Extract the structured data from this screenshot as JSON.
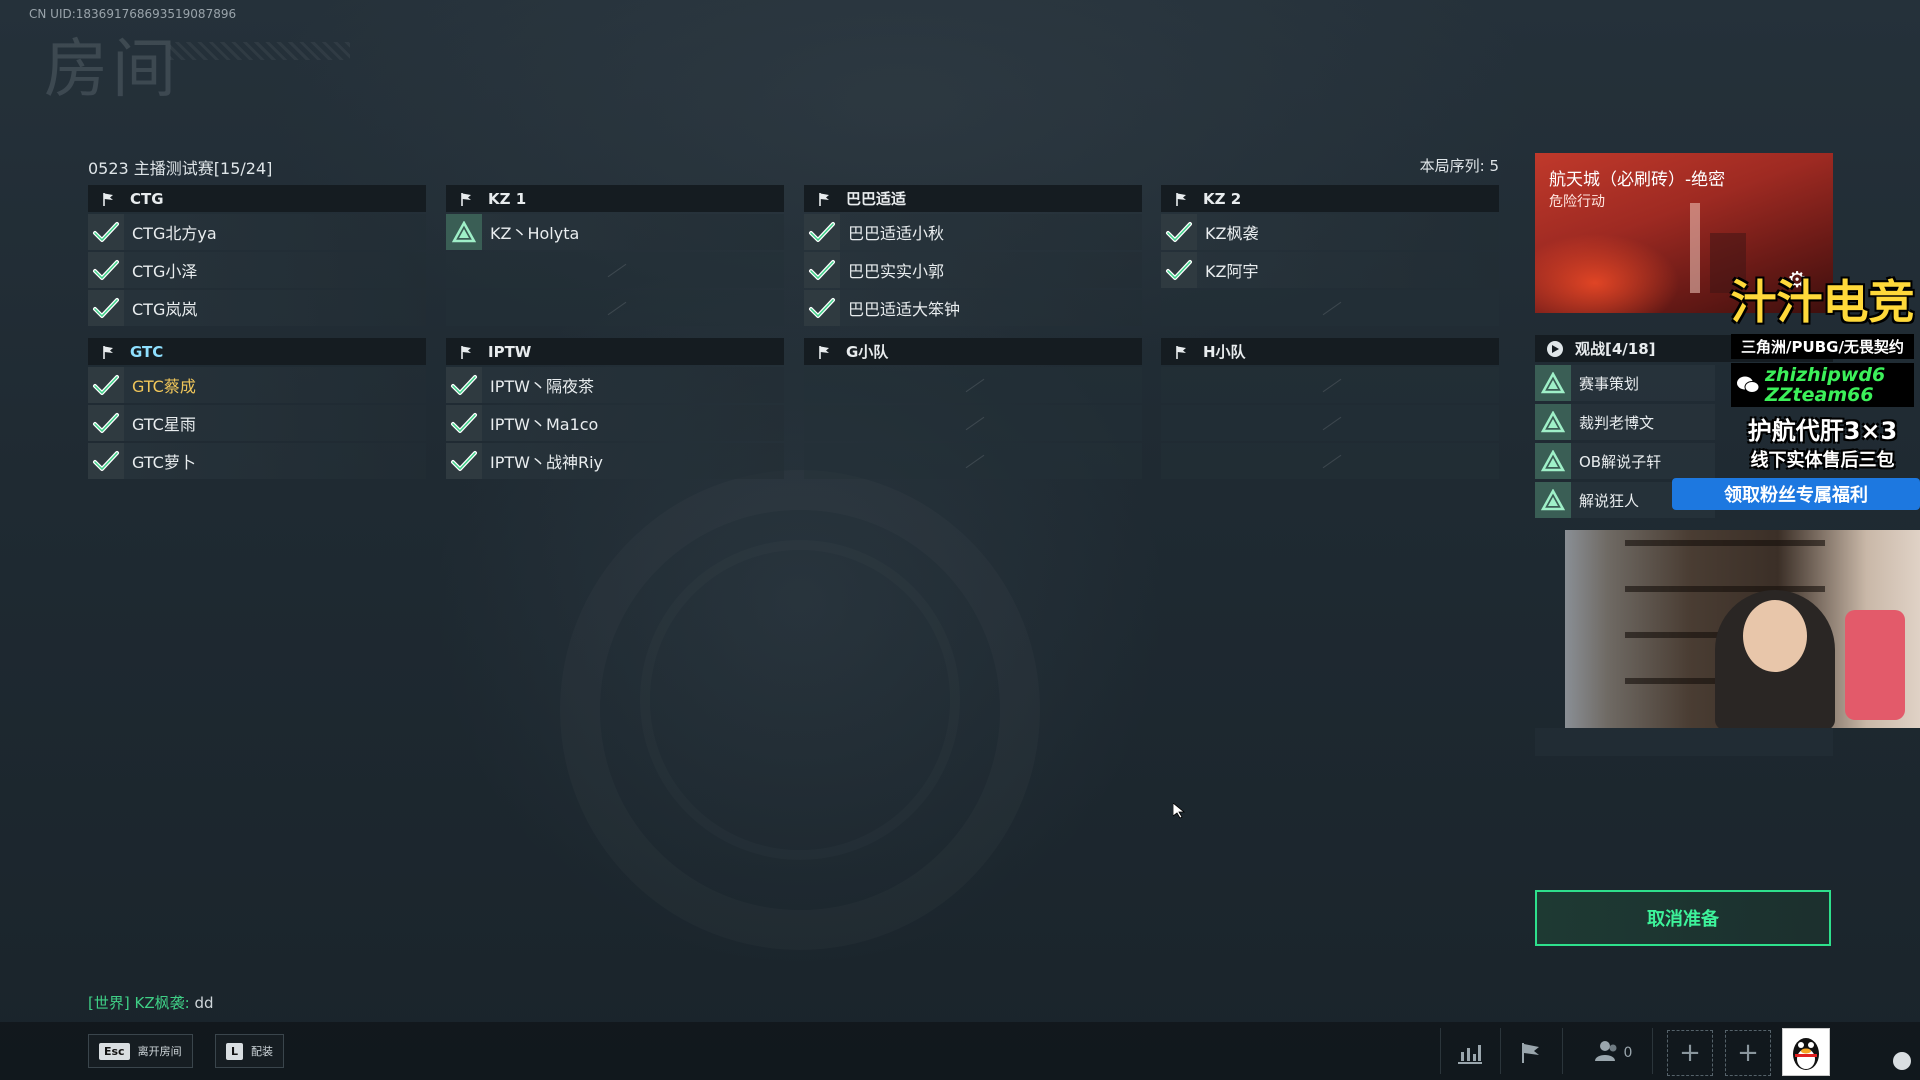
{
  "uid": "CN UID:1836917686935190878​96",
  "room_title": "房间",
  "match": {
    "title": "0523 主播测试赛[15/24]",
    "round_order": "本局序列:  5"
  },
  "teams": [
    {
      "name": "CTG",
      "players": [
        {
          "name": "CTG北方ya",
          "badge": "check"
        },
        {
          "name": "CTG小泽",
          "badge": "check"
        },
        {
          "name": "CTG岚岚",
          "badge": "check"
        }
      ]
    },
    {
      "name": "KZ 1",
      "players": [
        {
          "name": "KZ丶Holyta",
          "badge": "tri"
        },
        {
          "name": "",
          "badge": ""
        },
        {
          "name": "",
          "badge": ""
        }
      ]
    },
    {
      "name": "巴巴适适",
      "players": [
        {
          "name": "巴巴适适小秋",
          "badge": "check"
        },
        {
          "name": "巴巴实实小郭",
          "badge": "check"
        },
        {
          "name": "巴巴适适大笨钟",
          "badge": "check"
        }
      ]
    },
    {
      "name": "KZ 2",
      "players": [
        {
          "name": "KZ枫袭",
          "badge": "check"
        },
        {
          "name": "KZ阿宇",
          "badge": "check"
        },
        {
          "name": "",
          "badge": ""
        }
      ]
    },
    {
      "name": "GTC",
      "players": [
        {
          "name": "GTC蔡成",
          "badge": "check"
        },
        {
          "name": "GTC星雨",
          "badge": "check"
        },
        {
          "name": "GTC萝卜",
          "badge": "check"
        }
      ]
    },
    {
      "name": "IPTW",
      "players": [
        {
          "name": "IPTW丶隔夜茶",
          "badge": "check"
        },
        {
          "name": "IPTW丶Ma1co",
          "badge": "check"
        },
        {
          "name": "IPTW丶战神Riy",
          "badge": "check"
        }
      ]
    },
    {
      "name": "G小队",
      "players": [
        {
          "name": "",
          "badge": ""
        },
        {
          "name": "",
          "badge": ""
        },
        {
          "name": "",
          "badge": ""
        }
      ]
    },
    {
      "name": "H小队",
      "players": [
        {
          "name": "",
          "badge": ""
        },
        {
          "name": "",
          "badge": ""
        },
        {
          "name": "",
          "badge": ""
        }
      ]
    }
  ],
  "map": {
    "name": "航天城（必刷砖）-绝密",
    "mode": "危险行动"
  },
  "spectators": {
    "header": "观战[4/18]",
    "list": [
      "赛事策划",
      "裁判老博文",
      "OB解说子轩",
      "解说狂人"
    ]
  },
  "ad": {
    "brand": "汁汁电竞",
    "line1": "三角洲/PUBG/无畏契约",
    "wx1": "zhizhipwd6",
    "wx2": "ZZteam66",
    "line3": "护航代肝3×3",
    "line4": "线下实体售后三包",
    "button": "领取粉丝专属福利"
  },
  "cancel_ready": "取消准备",
  "chat": {
    "channel": "[世界]",
    "author": "KZ枫袭:",
    "message": "dd"
  },
  "bottom": {
    "esc_key": "Esc",
    "esc_label": "离开房间",
    "l_key": "L",
    "l_label": "配装",
    "friends_count": "0"
  },
  "colors": {
    "accent_green": "#3df29a",
    "gtc_blue": "#8fe0ff",
    "highlight_gold": "#f0c65a",
    "fan_button_blue": "#1d78e0"
  },
  "icons": [
    "flag-icon",
    "check-icon",
    "triangle-rank-icon",
    "play-icon",
    "gear-icon",
    "wechat-icon",
    "stats-icon",
    "friends-icon",
    "plus-icon",
    "qq-avatar-icon"
  ]
}
